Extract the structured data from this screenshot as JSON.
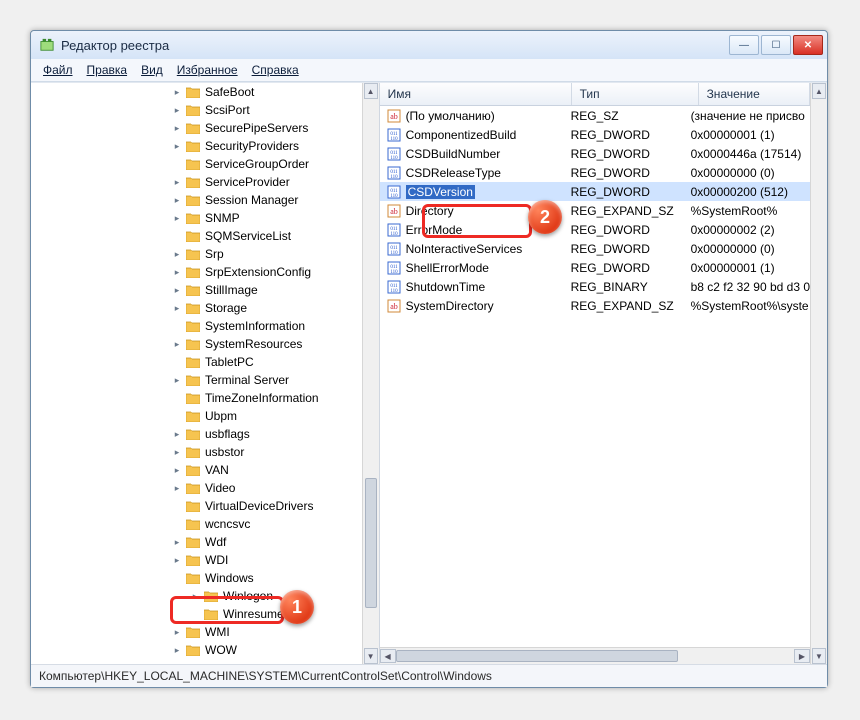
{
  "window_title": "Редактор реестра",
  "menu": [
    "Файл",
    "Правка",
    "Вид",
    "Избранное",
    "Справка"
  ],
  "tree": [
    {
      "label": "SafeBoot",
      "exp": "▸"
    },
    {
      "label": "ScsiPort",
      "exp": "▸"
    },
    {
      "label": "SecurePipeServers",
      "exp": "▸"
    },
    {
      "label": "SecurityProviders",
      "exp": "▸"
    },
    {
      "label": "ServiceGroupOrder",
      "exp": ""
    },
    {
      "label": "ServiceProvider",
      "exp": "▸"
    },
    {
      "label": "Session Manager",
      "exp": "▸"
    },
    {
      "label": "SNMP",
      "exp": "▸"
    },
    {
      "label": "SQMServiceList",
      "exp": ""
    },
    {
      "label": "Srp",
      "exp": "▸"
    },
    {
      "label": "SrpExtensionConfig",
      "exp": "▸"
    },
    {
      "label": "StillImage",
      "exp": "▸"
    },
    {
      "label": "Storage",
      "exp": "▸"
    },
    {
      "label": "SystemInformation",
      "exp": ""
    },
    {
      "label": "SystemResources",
      "exp": "▸"
    },
    {
      "label": "TabletPC",
      "exp": ""
    },
    {
      "label": "Terminal Server",
      "exp": "▸"
    },
    {
      "label": "TimeZoneInformation",
      "exp": ""
    },
    {
      "label": "Ubpm",
      "exp": ""
    },
    {
      "label": "usbflags",
      "exp": "▸"
    },
    {
      "label": "usbstor",
      "exp": "▸"
    },
    {
      "label": "VAN",
      "exp": "▸"
    },
    {
      "label": "Video",
      "exp": "▸"
    },
    {
      "label": "VirtualDeviceDrivers",
      "exp": ""
    },
    {
      "label": "wcncsvc",
      "exp": ""
    },
    {
      "label": "Wdf",
      "exp": "▸"
    },
    {
      "label": "WDI",
      "exp": "▸"
    },
    {
      "label": "Windows",
      "exp": ""
    },
    {
      "label": "Winlogon",
      "exp": "▸",
      "indent": 1
    },
    {
      "label": "Winresume",
      "exp": "",
      "indent": 1
    },
    {
      "label": "WMI",
      "exp": "▸"
    },
    {
      "label": "WOW",
      "exp": "▸"
    }
  ],
  "tree_selected_index": 27,
  "columns": {
    "name": "Имя",
    "type": "Тип",
    "value": "Значение"
  },
  "rows": [
    {
      "icon": "str",
      "name": "(По умолчанию)",
      "type": "REG_SZ",
      "value": "(значение не присво"
    },
    {
      "icon": "bin",
      "name": "ComponentizedBuild",
      "type": "REG_DWORD",
      "value": "0x00000001 (1)"
    },
    {
      "icon": "bin",
      "name": "CSDBuildNumber",
      "type": "REG_DWORD",
      "value": "0x0000446a (17514)"
    },
    {
      "icon": "bin",
      "name": "CSDReleaseType",
      "type": "REG_DWORD",
      "value": "0x00000000 (0)"
    },
    {
      "icon": "bin",
      "name": "CSDVersion",
      "type": "REG_DWORD",
      "value": "0x00000200 (512)",
      "selected": true
    },
    {
      "icon": "str",
      "name": "Directory",
      "type": "REG_EXPAND_SZ",
      "value": "%SystemRoot%"
    },
    {
      "icon": "bin",
      "name": "ErrorMode",
      "type": "REG_DWORD",
      "value": "0x00000002 (2)"
    },
    {
      "icon": "bin",
      "name": "NoInteractiveServices",
      "type": "REG_DWORD",
      "value": "0x00000000 (0)"
    },
    {
      "icon": "bin",
      "name": "ShellErrorMode",
      "type": "REG_DWORD",
      "value": "0x00000001 (1)"
    },
    {
      "icon": "bin",
      "name": "ShutdownTime",
      "type": "REG_BINARY",
      "value": "b8 c2 f2 32 90 bd d3 0"
    },
    {
      "icon": "str",
      "name": "SystemDirectory",
      "type": "REG_EXPAND_SZ",
      "value": "%SystemRoot%\\syste"
    }
  ],
  "status": "Компьютер\\HKEY_LOCAL_MACHINE\\SYSTEM\\CurrentControlSet\\Control\\Windows",
  "annot": {
    "one": "1",
    "two": "2"
  }
}
